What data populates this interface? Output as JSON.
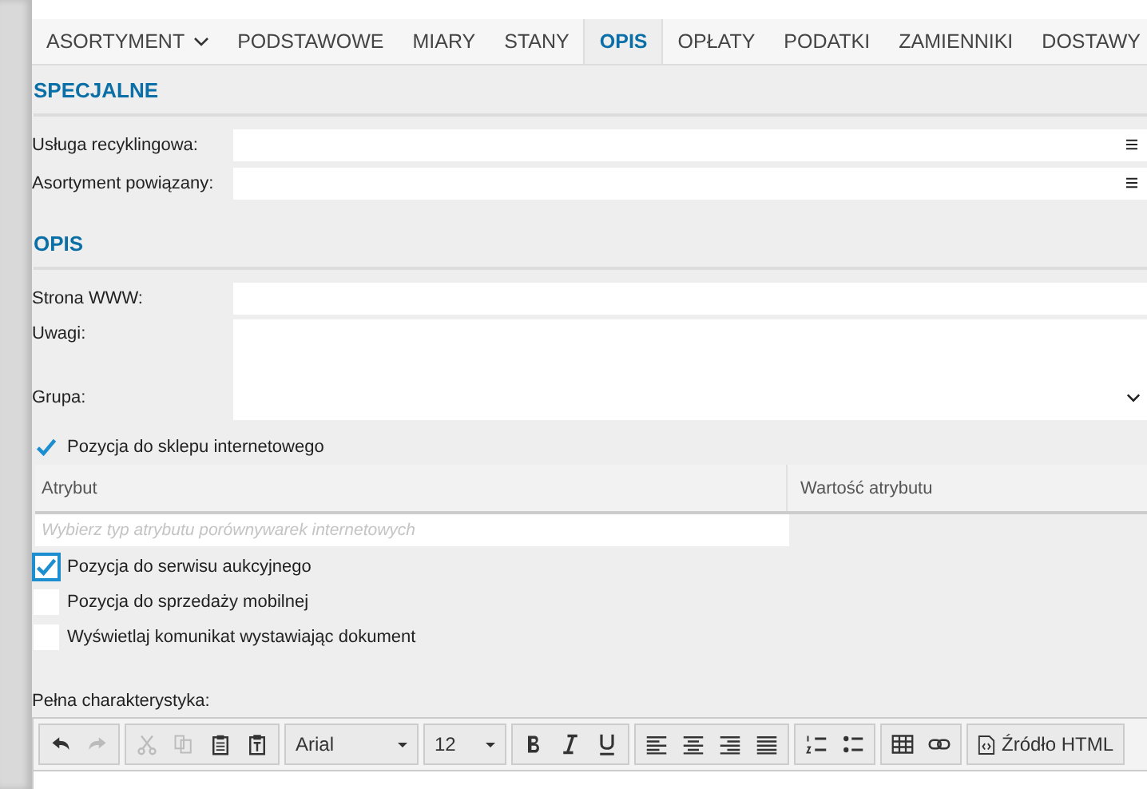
{
  "tabs": [
    {
      "label": "ASORTYMENT",
      "selected": false,
      "has_menu": true
    },
    {
      "label": "PODSTAWOWE",
      "selected": false,
      "has_menu": false
    },
    {
      "label": "MIARY",
      "selected": false,
      "has_menu": false
    },
    {
      "label": "STANY",
      "selected": false,
      "has_menu": false
    },
    {
      "label": "OPIS",
      "selected": true,
      "has_menu": false
    },
    {
      "label": "OPŁATY",
      "selected": false,
      "has_menu": false
    },
    {
      "label": "PODATKI",
      "selected": false,
      "has_menu": false
    },
    {
      "label": "ZAMIENNIKI",
      "selected": false,
      "has_menu": false
    },
    {
      "label": "DOSTAWY",
      "selected": false,
      "has_menu": false
    }
  ],
  "special": {
    "title": "SPECJALNE",
    "fields": [
      {
        "label": "Usługa recyklingowa:",
        "kind": "lookup"
      },
      {
        "label": "Asortyment powiązany:",
        "kind": "lookup"
      }
    ]
  },
  "description": {
    "title": "OPIS",
    "fields": [
      {
        "label": "Strona WWW:",
        "kind": "text"
      },
      {
        "label": "Uwagi:",
        "kind": "textarea"
      },
      {
        "label": "Grupa:",
        "kind": "select"
      }
    ]
  },
  "shop_checkbox": {
    "label": "Pozycja do sklepu internetowego",
    "checked": true,
    "focused": false
  },
  "attributes": {
    "columns": [
      "Atrybut",
      "Wartość atrybutu"
    ],
    "placeholder": "Wybierz typ atrybutu porównywarek internetowych"
  },
  "checkboxes": [
    {
      "label": "Pozycja do serwisu aukcyjnego",
      "checked": true,
      "focused": true
    },
    {
      "label": "Pozycja do sprzedaży mobilnej",
      "checked": false,
      "focused": false
    },
    {
      "label": "Wyświetlaj komunikat wystawiając dokument",
      "checked": false,
      "focused": false
    }
  ],
  "editor": {
    "label": "Pełna charakterystyka:",
    "font": "Arial",
    "size": "12",
    "source_button": "Źródło HTML",
    "undo_disabled": false,
    "redo_disabled": true,
    "cut_disabled": true,
    "copy_disabled": true
  }
}
